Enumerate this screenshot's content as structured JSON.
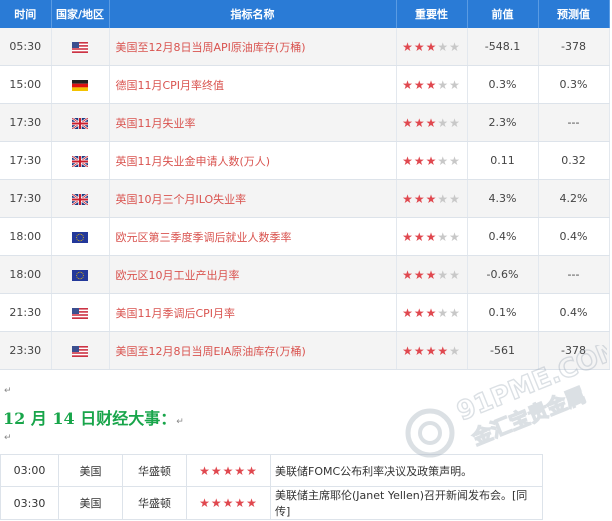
{
  "headers": {
    "time": "时间",
    "country": "国家/地区",
    "name": "指标名称",
    "importance": "重要性",
    "prev": "前值",
    "forecast": "预测值"
  },
  "rows": [
    {
      "time": "05:30",
      "flag": "us",
      "name": "美国至12月8日当周API原油库存(万桶)",
      "stars": 3,
      "prev": "-548.1",
      "forecast": "-378"
    },
    {
      "time": "15:00",
      "flag": "de",
      "name": "德国11月CPI月率终值",
      "stars": 3,
      "prev": "0.3%",
      "forecast": "0.3%"
    },
    {
      "time": "17:30",
      "flag": "uk",
      "name": "英国11月失业率",
      "stars": 3,
      "prev": "2.3%",
      "forecast": "---"
    },
    {
      "time": "17:30",
      "flag": "uk",
      "name": "英国11月失业金申请人数(万人)",
      "stars": 3,
      "prev": "0.11",
      "forecast": "0.32"
    },
    {
      "time": "17:30",
      "flag": "uk",
      "name": "英国10月三个月ILO失业率",
      "stars": 3,
      "prev": "4.3%",
      "forecast": "4.2%"
    },
    {
      "time": "18:00",
      "flag": "eu",
      "name": "欧元区第三季度季调后就业人数季率",
      "stars": 3,
      "prev": "0.4%",
      "forecast": "0.4%"
    },
    {
      "time": "18:00",
      "flag": "eu",
      "name": "欧元区10月工业产出月率",
      "stars": 3,
      "prev": "-0.6%",
      "forecast": "---"
    },
    {
      "time": "21:30",
      "flag": "us",
      "name": "美国11月季调后CPI月率",
      "stars": 3,
      "prev": "0.1%",
      "forecast": "0.4%"
    },
    {
      "time": "23:30",
      "flag": "us",
      "name": "美国至12月8日当周EIA原油库存(万桶)",
      "stars": 4,
      "prev": "-561",
      "forecast": "-378"
    }
  ],
  "paragraph_mark": "↵",
  "section_title": "12 月 14 日财经大事：",
  "events": [
    {
      "time": "03:00",
      "country": "美国",
      "city": "华盛顿",
      "stars": 5,
      "desc": "美联储FOMC公布利率决议及政策声明。"
    },
    {
      "time": "03:30",
      "country": "美国",
      "city": "华盛顿",
      "stars": 5,
      "desc": "美联储主席耶伦(Janet Yellen)召开新闻发布会。[同传]"
    }
  ],
  "watermark": {
    "text_top": "91PME.COM",
    "text_bottom": "金汇宝贵金属"
  },
  "colors": {
    "header_bg": "#2a7bd6",
    "event_text": "#d9534f",
    "star_on": "#e0484f",
    "star_off": "#c8c8c8",
    "title_green": "#18a54a"
  }
}
